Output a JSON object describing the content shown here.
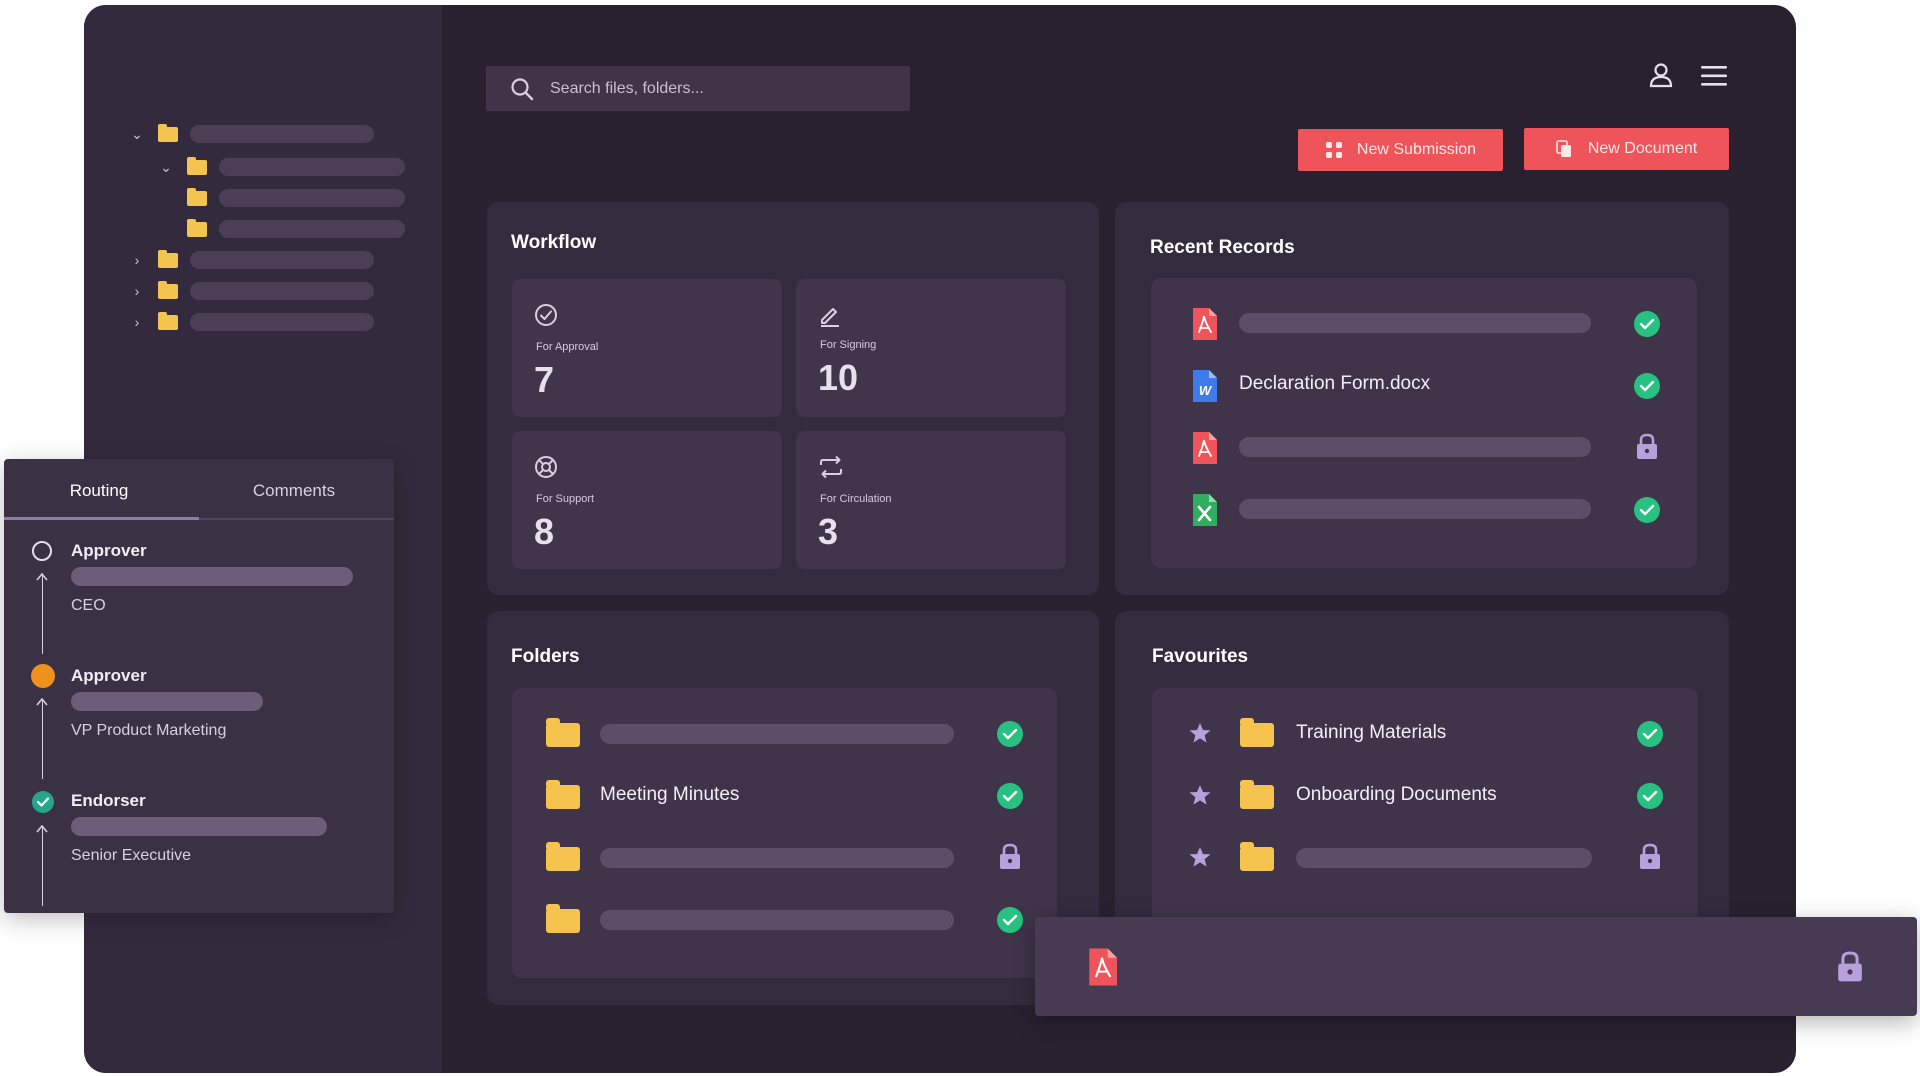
{
  "search": {
    "placeholder": "Search files, folders..."
  },
  "header": {
    "new_submission_label": "New Submission",
    "new_document_label": "New Document"
  },
  "workflow": {
    "title": "Workflow",
    "tiles": [
      {
        "label": "For Approval",
        "count": "7",
        "icon": "check-circle-icon"
      },
      {
        "label": "For Signing",
        "count": "10",
        "icon": "pen-icon"
      },
      {
        "label": "For Support",
        "count": "8",
        "icon": "lifebuoy-icon"
      },
      {
        "label": "For Circulation",
        "count": "3",
        "icon": "repeat-icon"
      }
    ]
  },
  "recent_records": {
    "title": "Recent Records",
    "items": [
      {
        "type": "pdf",
        "name": "",
        "status": "done"
      },
      {
        "type": "word",
        "name": "Declaration Form.docx",
        "status": "done"
      },
      {
        "type": "pdf",
        "name": "",
        "status": "locked"
      },
      {
        "type": "excel",
        "name": "",
        "status": "done"
      }
    ]
  },
  "folders": {
    "title": "Folders",
    "items": [
      {
        "name": "",
        "status": "done"
      },
      {
        "name": "Meeting Minutes",
        "status": "done"
      },
      {
        "name": "",
        "status": "locked"
      },
      {
        "name": "",
        "status": "done"
      }
    ]
  },
  "favourites": {
    "title": "Favourites",
    "items": [
      {
        "name": "Training Materials",
        "status": "done"
      },
      {
        "name": "Onboarding Documents",
        "status": "done"
      },
      {
        "name": "",
        "status": "locked"
      }
    ]
  },
  "routing": {
    "tabs": [
      "Routing",
      "Comments"
    ],
    "active_tab": "Routing",
    "steps": [
      {
        "title": "Approver",
        "role": "CEO",
        "state": "pending"
      },
      {
        "title": "Approver",
        "role": "VP Product Marketing",
        "state": "current"
      },
      {
        "title": "Endorser",
        "role": "Senior Executive",
        "state": "done"
      }
    ]
  },
  "colors": {
    "accent": "#f0545b",
    "success": "#27c281",
    "folder": "#f6c44e",
    "current_step": "#f0901e",
    "lock": "#b7a0dc"
  }
}
